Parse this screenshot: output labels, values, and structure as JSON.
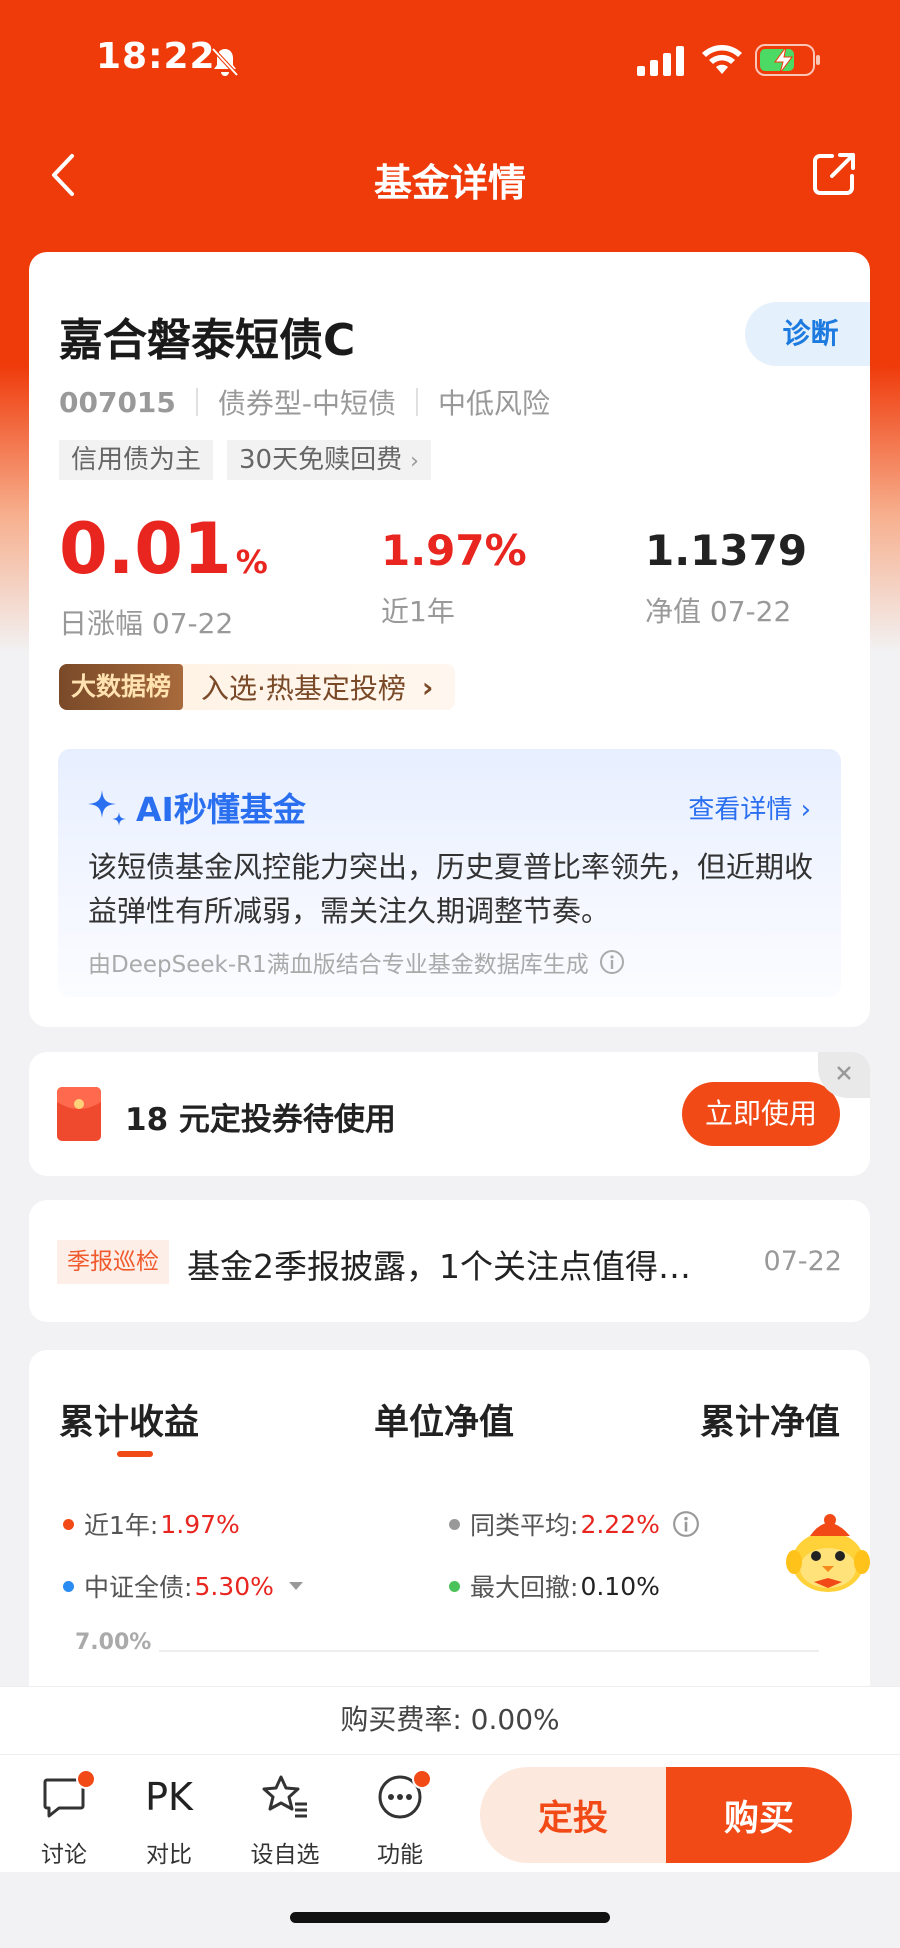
{
  "status_bar": {
    "time": "18:22"
  },
  "nav": {
    "title": "基金详情"
  },
  "fund": {
    "name": "嘉合磐泰短债C",
    "diagnose_label": "诊断",
    "code": "007015",
    "type": "债券型-中短债",
    "risk": "中低风险",
    "tags": [
      "信用债为主",
      "30天免赎回费"
    ],
    "daily_change_value": "0.01",
    "daily_change_unit": "%",
    "daily_change_label": "日涨幅 07-22",
    "year_return_value": "1.97%",
    "year_return_label": "近1年",
    "nav_value": "1.1379",
    "nav_label": "净值 07-22",
    "big_data_badge": "大数据榜",
    "big_data_text": "入选·热基定投榜"
  },
  "ai": {
    "title": "AI秒懂基金",
    "link": "查看详情",
    "body": "该短债基金风控能力突出，历史夏普比率领先，但近期收益弹性有所减弱，需关注久期调整节奏。",
    "footer": "由DeepSeek-R1满血版结合专业基金数据库生成"
  },
  "voucher": {
    "text": "18 元定投券待使用",
    "button": "立即使用"
  },
  "news": {
    "tag": "季报巡检",
    "text": "基金2季报披露，1个关注点值得…",
    "date": "07-22"
  },
  "chart_tabs": [
    "累计收益",
    "单位净值",
    "累计净值"
  ],
  "legend": {
    "year_label": "近1年:",
    "year_value": "1.97%",
    "peer_label": "同类平均:",
    "peer_value": "2.22%",
    "index_label": "中证全债:",
    "index_value": "5.30%",
    "drawdown_label": "最大回撤:",
    "drawdown_value": "0.10%"
  },
  "chart_data": {
    "type": "line",
    "y_ticks": [
      "7.00%"
    ]
  },
  "fee": {
    "text": "购买费率: 0.00%"
  },
  "bottom_bar": {
    "discuss": "讨论",
    "compare_icon_text": "PK",
    "compare": "对比",
    "watchlist": "设自选",
    "functions": "功能",
    "fixed_invest": "定投",
    "buy": "购买"
  },
  "colors": {
    "brand": "#ef3a0a",
    "accent": "#f24a16",
    "red": "#e8251f",
    "ai_blue": "#2a6ff0"
  }
}
